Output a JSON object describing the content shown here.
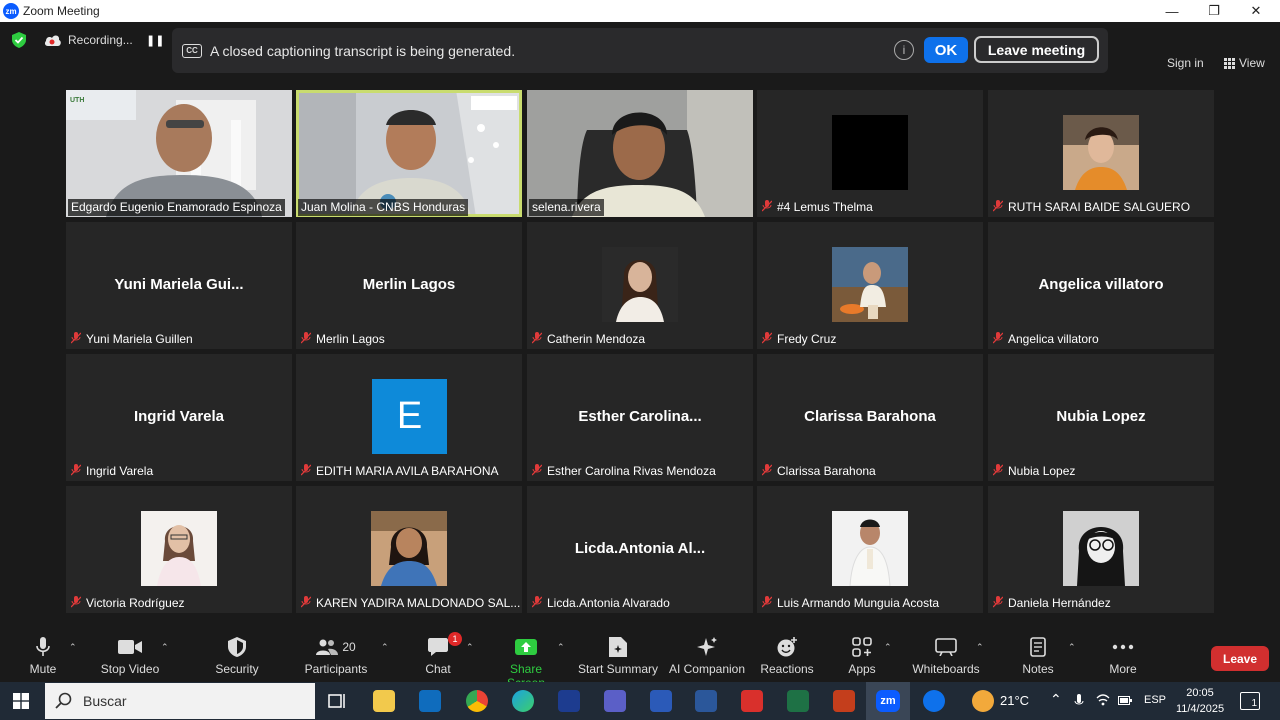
{
  "window": {
    "title": "Zoom Meeting",
    "logo_text": "zm"
  },
  "topbar": {
    "recording_label": "Recording...",
    "pause_symbol": "❚❚",
    "signin_label": "Sign in",
    "view_label": "View"
  },
  "cc_banner": {
    "icon_text": "CC",
    "message": "A closed captioning transcript is being generated.",
    "info_symbol": "i",
    "ok_label": "OK",
    "leave_label": "Leave meeting"
  },
  "participants": [
    {
      "name": "Edgardo Eugenio Enamorado Espinoza",
      "kind": "video",
      "muted": false,
      "speaking_bar": true
    },
    {
      "name": "Juan Molina - CNBS Honduras",
      "kind": "video",
      "muted": false,
      "active": true
    },
    {
      "name": "selena.rivera",
      "kind": "video",
      "muted": false
    },
    {
      "name": "#4 Lemus Thelma",
      "kind": "black-photo",
      "muted": true
    },
    {
      "name": "RUTH SARAI BAIDE SALGUERO",
      "kind": "photo",
      "muted": true
    },
    {
      "name": "Yuni Mariela Guillen",
      "display": "Yuni Mariela Gui...",
      "kind": "name",
      "muted": true
    },
    {
      "name": "Merlin Lagos",
      "display": "Merlin Lagos",
      "kind": "name",
      "muted": true
    },
    {
      "name": "Catherin Mendoza",
      "kind": "photo",
      "muted": true
    },
    {
      "name": "Fredy Cruz",
      "kind": "photo",
      "muted": true
    },
    {
      "name": "Angelica villatoro",
      "display": "Angelica villatoro",
      "kind": "name",
      "muted": true
    },
    {
      "name": "Ingrid Varela",
      "display": "Ingrid Varela",
      "kind": "name",
      "muted": true
    },
    {
      "name": "EDITH MARIA AVILA BARAHONA",
      "kind": "letter",
      "letter": "E",
      "muted": true
    },
    {
      "name": "Esther Carolina Rivas Mendoza",
      "display": "Esther  Carolina...",
      "kind": "name",
      "muted": true
    },
    {
      "name": "Clarissa Barahona",
      "display": "Clarissa Barahona",
      "kind": "name",
      "muted": true
    },
    {
      "name": "Nubia Lopez",
      "display": "Nubia Lopez",
      "kind": "name",
      "muted": true
    },
    {
      "name": "Victoria Rodríguez",
      "kind": "photo",
      "muted": true
    },
    {
      "name": "KAREN YADIRA MALDONADO SAL...",
      "kind": "photo",
      "muted": true
    },
    {
      "name": "Licda.Antonia Alvarado",
      "display": "Licda.Antonia  Al...",
      "kind": "name",
      "muted": true
    },
    {
      "name": "Luis Armando Munguia Acosta",
      "kind": "photo",
      "muted": true
    },
    {
      "name": "Daniela Hernández",
      "kind": "photo",
      "muted": true
    }
  ],
  "toolbar": {
    "mute": "Mute",
    "stop_video": "Stop Video",
    "security": "Security",
    "participants": "Participants",
    "participants_count": "20",
    "chat": "Chat",
    "chat_badge": "1",
    "share_screen": "Share Screen",
    "start_summary": "Start Summary",
    "ai_companion": "AI Companion",
    "reactions": "Reactions",
    "apps": "Apps",
    "whiteboards": "Whiteboards",
    "notes": "Notes",
    "more": "More",
    "leave": "Leave"
  },
  "taskbar": {
    "search_placeholder": "Buscar",
    "temperature": "21°C",
    "language": "ESP",
    "time": "20:05",
    "date": "11/4/2025",
    "notification_count": "1"
  },
  "colors": {
    "accent_blue": "#0e71eb",
    "share_green": "#2ecc40",
    "leave_red": "#d12f2f",
    "active_speaker": "#c9dc6f"
  }
}
